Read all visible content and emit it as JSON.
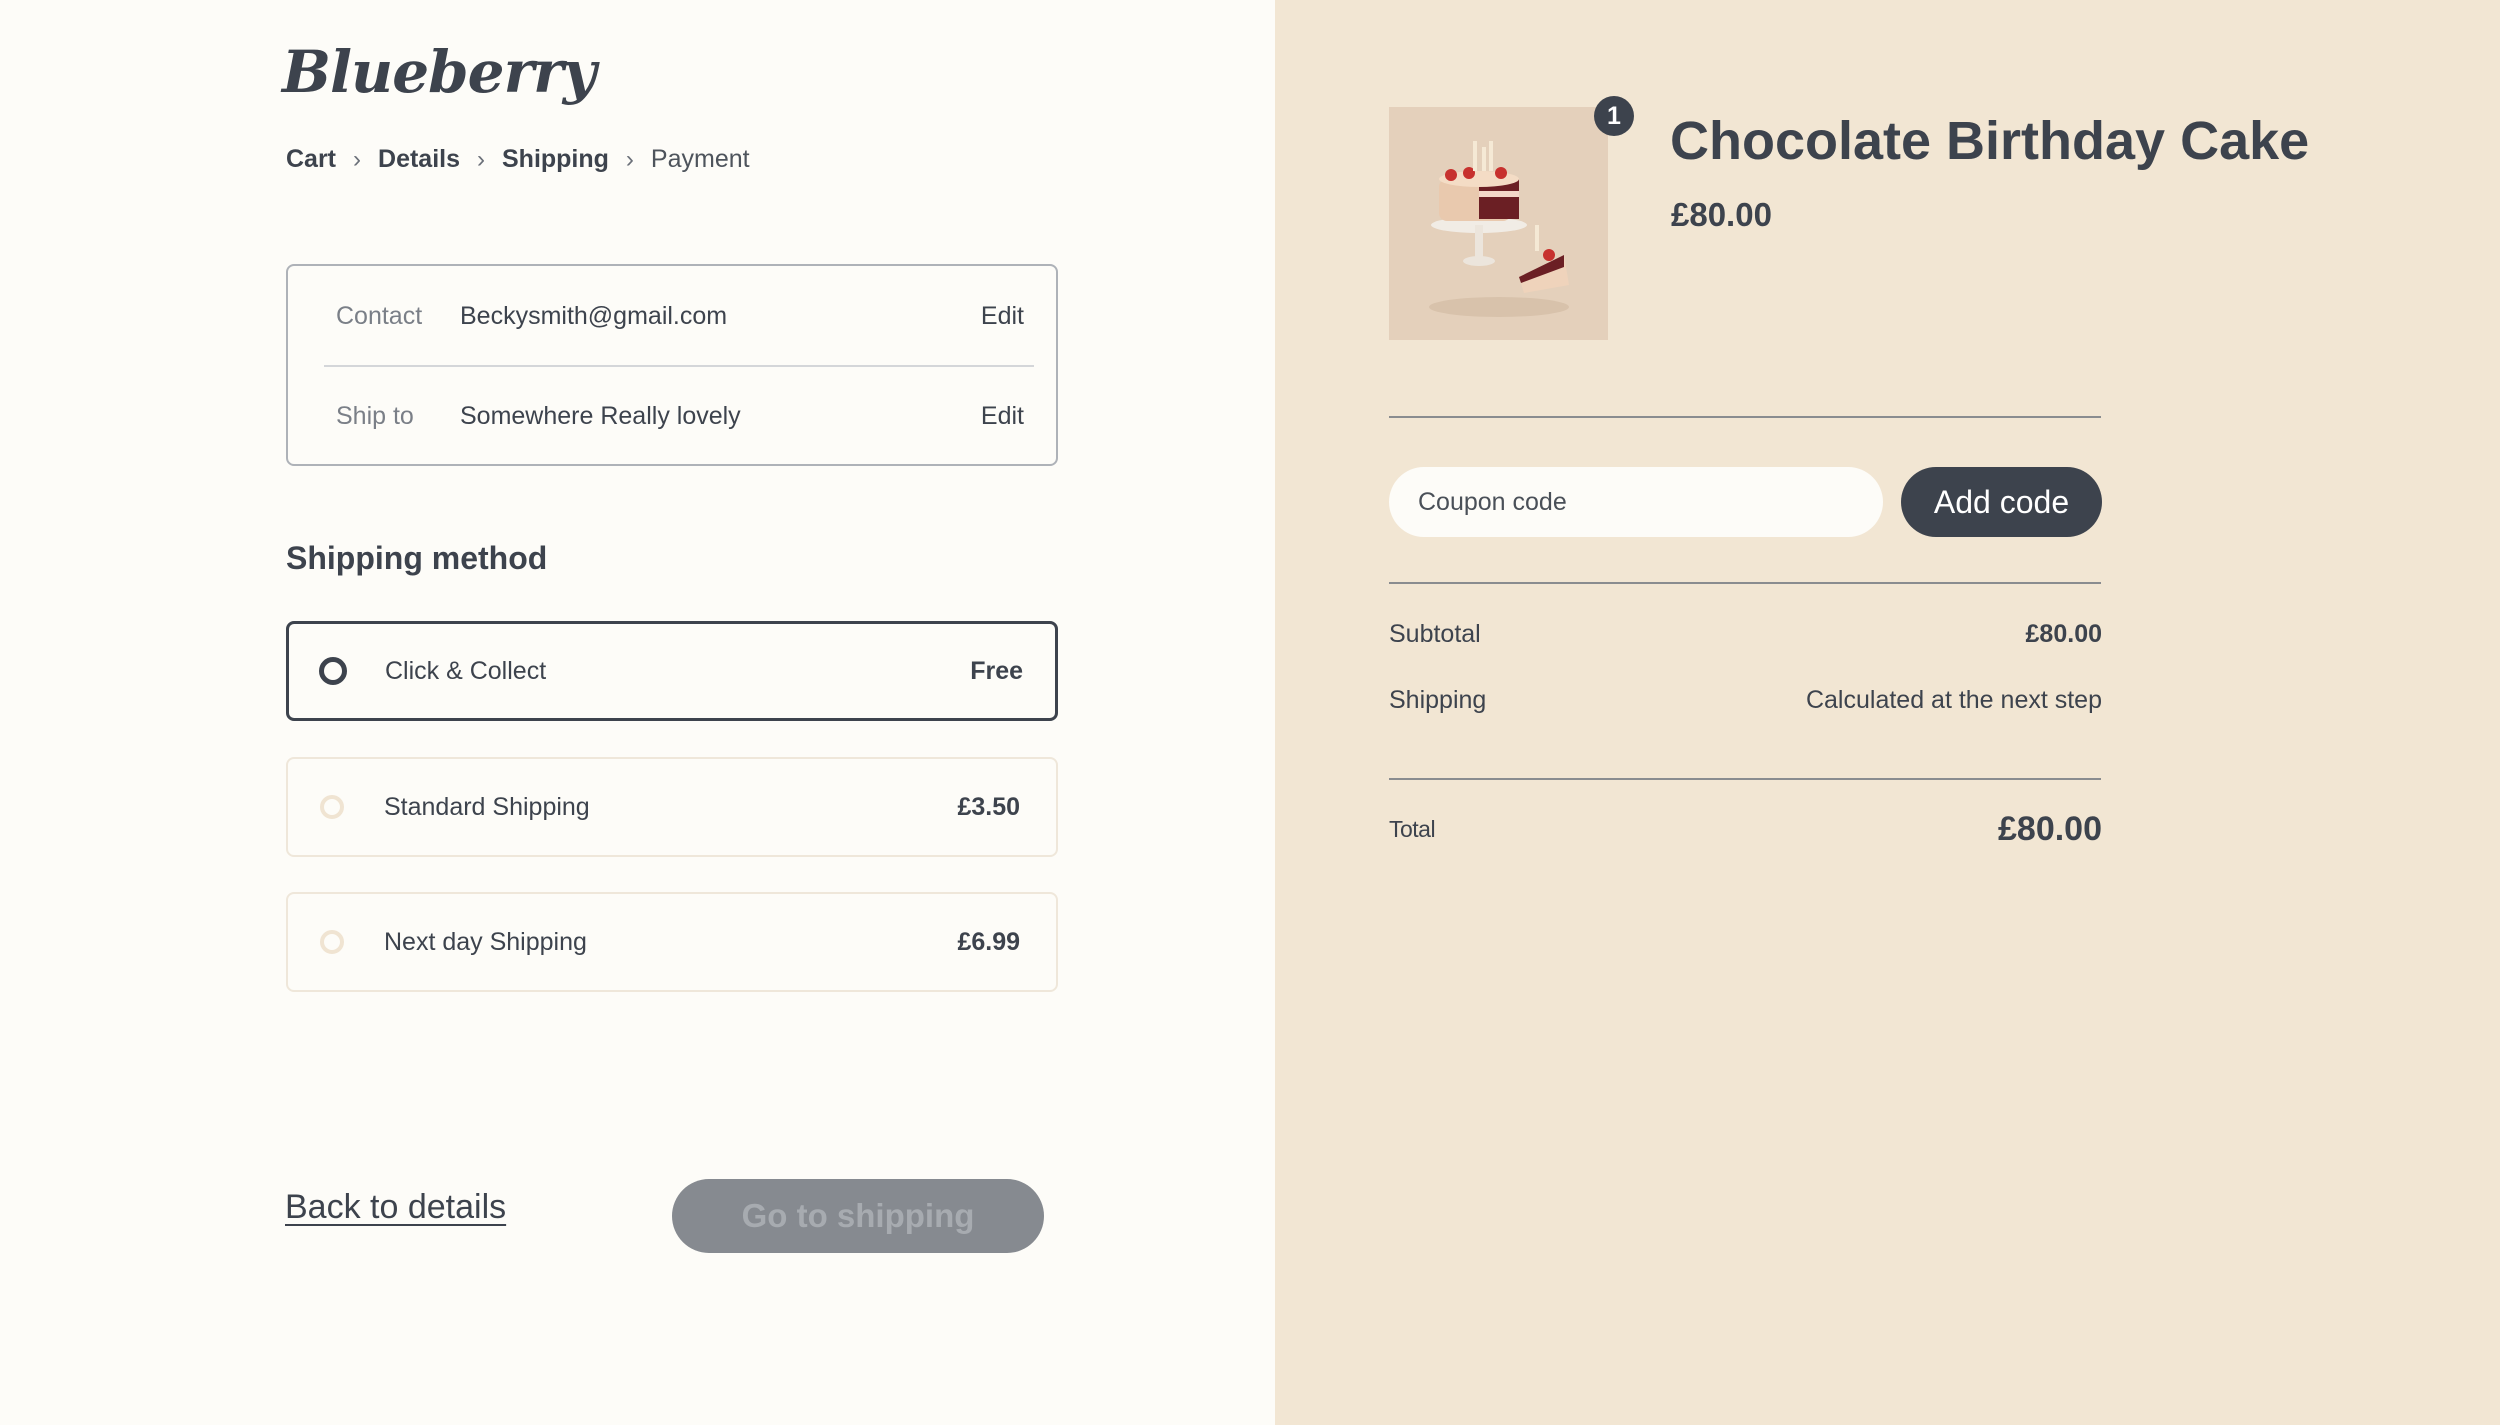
{
  "brand": {
    "logo": "Blueberry"
  },
  "breadcrumb": {
    "items": [
      {
        "label": "Cart"
      },
      {
        "label": "Details"
      },
      {
        "label": "Shipping"
      },
      {
        "label": "Payment"
      }
    ],
    "separator": "›"
  },
  "summary_box": {
    "contact_label": "Contact",
    "contact_value": "Beckysmith@gmail.com",
    "contact_edit": "Edit",
    "ship_label": "Ship to",
    "ship_value": "Somewhere Really lovely",
    "ship_edit": "Edit"
  },
  "shipping": {
    "heading": "Shipping method",
    "options": [
      {
        "name": "Click & Collect",
        "price": "Free",
        "selected": true
      },
      {
        "name": "Standard Shipping",
        "price": "£3.50",
        "selected": false
      },
      {
        "name": "Next day Shipping",
        "price": "£6.99",
        "selected": false
      }
    ]
  },
  "footer": {
    "back_label": "Back to details",
    "go_label": "Go to shipping"
  },
  "order": {
    "quantity_badge": "1",
    "product_title": "Chocolate Birthday Cake",
    "product_price": "£80.00",
    "coupon_placeholder": "Coupon code",
    "add_code_label": "Add code",
    "subtotal_label": "Subtotal",
    "subtotal_value": "£80.00",
    "shipping_label": "Shipping",
    "shipping_value": "Calculated at the next step",
    "total_label": "Total",
    "total_value": "£80.00"
  },
  "colors": {
    "accent": "#3d434d",
    "panel": "#f2e6d3",
    "background": "#fdfcf8",
    "disabled_button": "#868a90"
  }
}
